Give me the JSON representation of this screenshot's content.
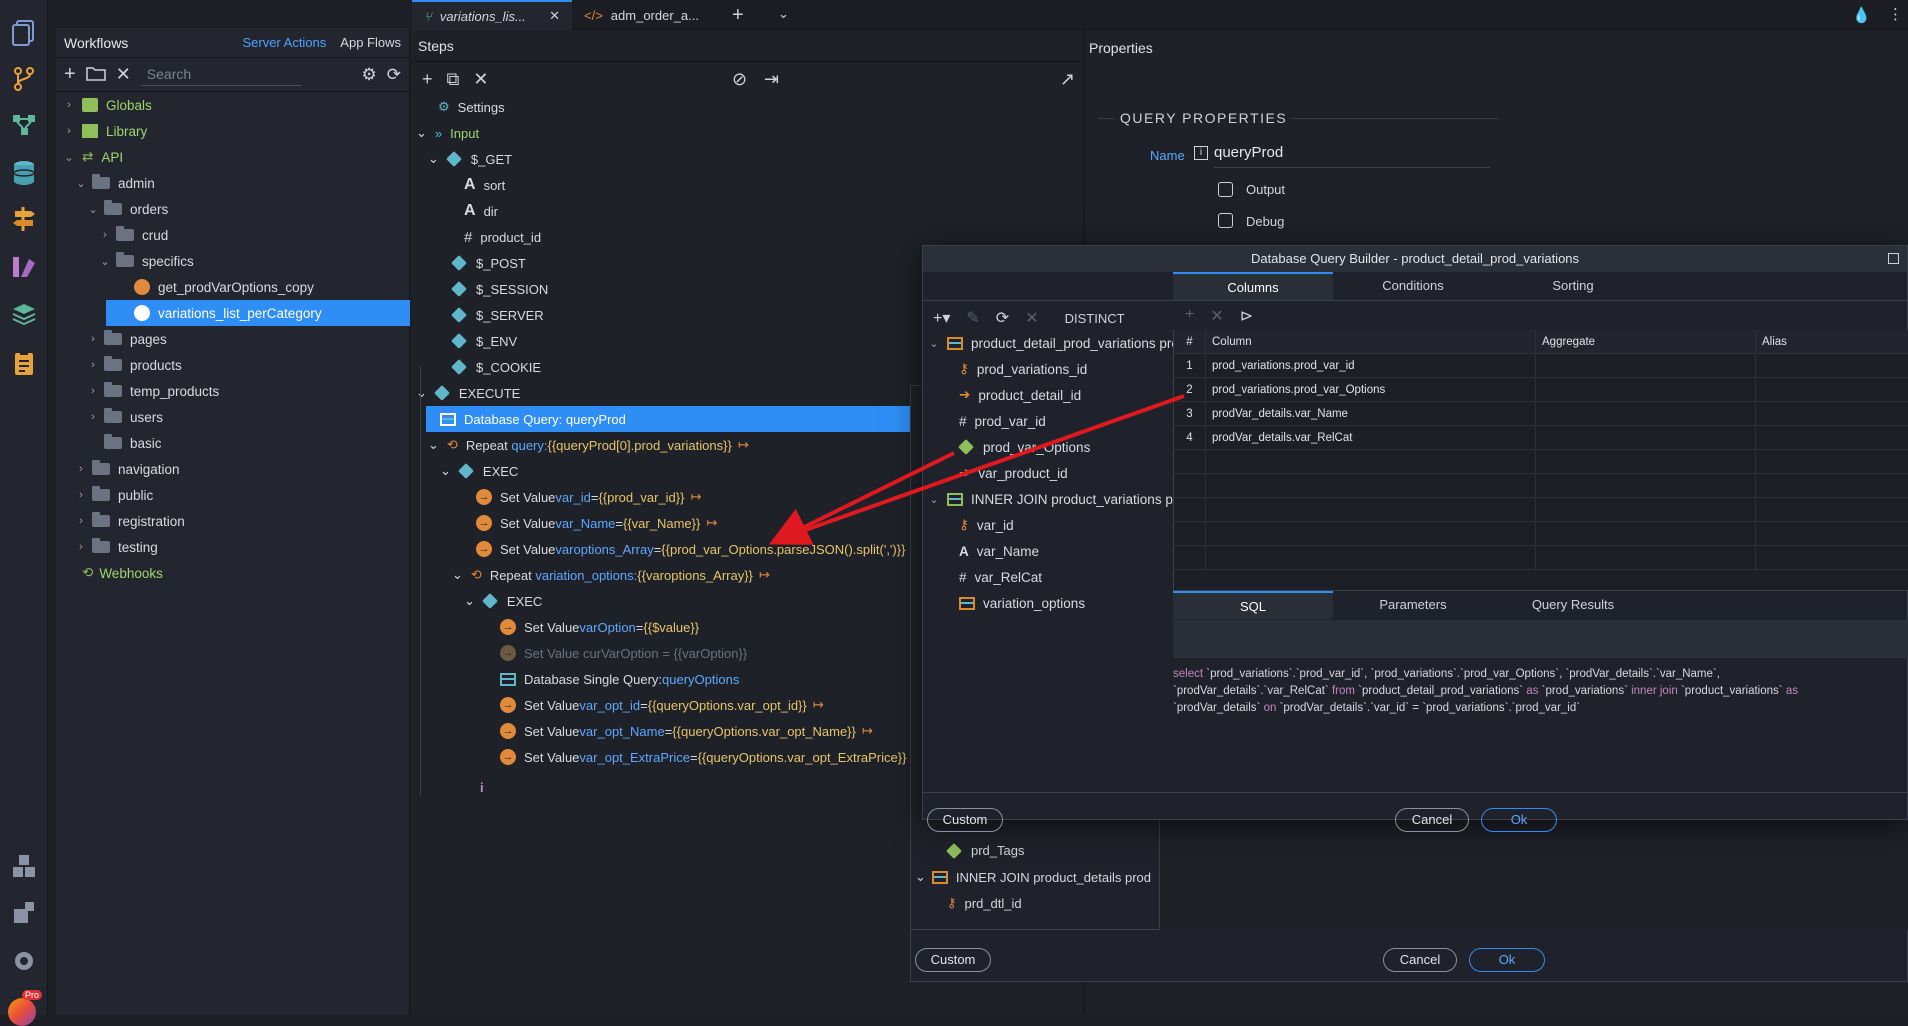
{
  "tabs": [
    {
      "label": "variations_lis..."
    },
    {
      "label": "adm_order_a..."
    }
  ],
  "workflows": {
    "title": "Workflows",
    "tab_server": "Server Actions",
    "tab_app": "App Flows",
    "search_placeholder": "Search",
    "tree": [
      {
        "label": "Globals"
      },
      {
        "label": "Library"
      },
      {
        "label": "API"
      },
      {
        "label": "admin"
      },
      {
        "label": "orders"
      },
      {
        "label": "crud"
      },
      {
        "label": "specifics"
      },
      {
        "label": "get_prodVarOptions_copy"
      },
      {
        "label": "variations_list_perCategory"
      },
      {
        "label": "pages"
      },
      {
        "label": "products"
      },
      {
        "label": "temp_products"
      },
      {
        "label": "users"
      },
      {
        "label": "basic"
      },
      {
        "label": "navigation"
      },
      {
        "label": "public"
      },
      {
        "label": "registration"
      },
      {
        "label": "testing"
      },
      {
        "label": "Webhooks"
      }
    ]
  },
  "steps": {
    "title": "Steps",
    "settings": "Settings",
    "input": "Input",
    "get": "$_GET",
    "sort": "sort",
    "dir": "dir",
    "product_id": "product_id",
    "post": "$_POST",
    "session": "$_SESSION",
    "server": "$_SERVER",
    "env": "$_ENV",
    "cookie": "$_COOKIE",
    "execute": "EXECUTE",
    "db_query": "Database Query: queryProd",
    "repeat1_a": "Repeat",
    "repeat1_b": "query: ",
    "repeat1_c": "{{queryProd[0].prod_variations}}",
    "exec": "EXEC",
    "sv1_a": "Set Value ",
    "sv1_b": "var_id",
    "sv1_c": " = ",
    "sv1_d": "{{prod_var_id}}",
    "sv2_b": "var_Name",
    "sv2_d": "{{var_Name}}",
    "sv3_b": "varoptions_Array",
    "sv3_d": "{{prod_var_Options.parseJSON().split(',')}}",
    "repeat2_b": "variation_options: ",
    "repeat2_c": "{{varoptions_Array}}",
    "sv4_b": "varOption",
    "sv4_d": "{{$value}}",
    "sv5": "Set Value curVarOption = {{varOption}}",
    "dbsingle_a": "Database Single Query: ",
    "dbsingle_b": "queryOptions",
    "sv6_b": "var_opt_id",
    "sv6_d": "{{queryOptions.var_opt_id}}",
    "sv7_b": "var_opt_Name",
    "sv7_d": "{{queryOptions.var_opt_Name}}",
    "sv8_b": "var_opt_ExtraPrice",
    "sv8_d": "{{queryOptions.var_opt_ExtraPrice}}"
  },
  "properties": {
    "title": "Properties",
    "section": "QUERY PROPERTIES",
    "name_label": "Name",
    "name_value": "queryProd",
    "output_label": "Output",
    "debug_label": "Debug"
  },
  "dialog": {
    "title": "Database Query Builder - product_detail_prod_variations",
    "tab_columns": "Columns",
    "tab_conditions": "Conditions",
    "tab_sorting": "Sorting",
    "distinct": "DISTINCT",
    "tables": [
      {
        "label": "product_detail_prod_variations pro"
      },
      {
        "label": "prod_variations_id"
      },
      {
        "label": "product_detail_id"
      },
      {
        "label": "prod_var_id"
      },
      {
        "label": "prod_var_Options"
      },
      {
        "label": "var_product_id"
      },
      {
        "label": "INNER JOIN product_variations pro"
      },
      {
        "label": "var_id"
      },
      {
        "label": "var_Name"
      },
      {
        "label": "var_RelCat"
      },
      {
        "label": "variation_options"
      }
    ],
    "grid_headers": {
      "num": "#",
      "column": "Column",
      "aggregate": "Aggregate",
      "alias": "Alias"
    },
    "grid_rows": [
      {
        "num": "1",
        "column": "prod_variations.prod_var_id"
      },
      {
        "num": "2",
        "column": "prod_variations.prod_var_Options"
      },
      {
        "num": "3",
        "column": "prodVar_details.var_Name"
      },
      {
        "num": "4",
        "column": "prodVar_details.var_RelCat"
      }
    ],
    "tab_sql": "SQL",
    "tab_params": "Parameters",
    "tab_results": "Query Results",
    "sql_l1_a": "select",
    "sql_l1_b": " `prod_variations`.`prod_var_id`, `prod_variations`.`prod_var_Options`, `prodVar_details`.`var_Name`,",
    "sql_l2_a": "`prodVar_details`.`var_RelCat` ",
    "sql_l2_b": "from",
    "sql_l2_c": " `product_detail_prod_variations` ",
    "sql_l2_d": "as",
    "sql_l2_e": " `prod_variations` ",
    "sql_l2_f": "inner join",
    "sql_l2_g": " `product_variations` ",
    "sql_l2_h": "as",
    "sql_l3_a": "`prodVar_details` ",
    "sql_l3_b": "on",
    "sql_l3_c": " `prodVar_details`.`var_id` = `prod_variations`.`prod_var_id`",
    "custom": "Custom",
    "cancel": "Cancel",
    "ok": "Ok"
  },
  "outer": {
    "prd_tags": "prd_Tags",
    "inner_join2": "INNER JOIN product_details prod",
    "prd_dtl_id": "prd_dtl_id",
    "custom": "Custom",
    "cancel": "Cancel",
    "ok": "Ok"
  },
  "badge": "Pro",
  "colors": {
    "accent": "#2f8ef5",
    "arrow": "#e0181f"
  }
}
